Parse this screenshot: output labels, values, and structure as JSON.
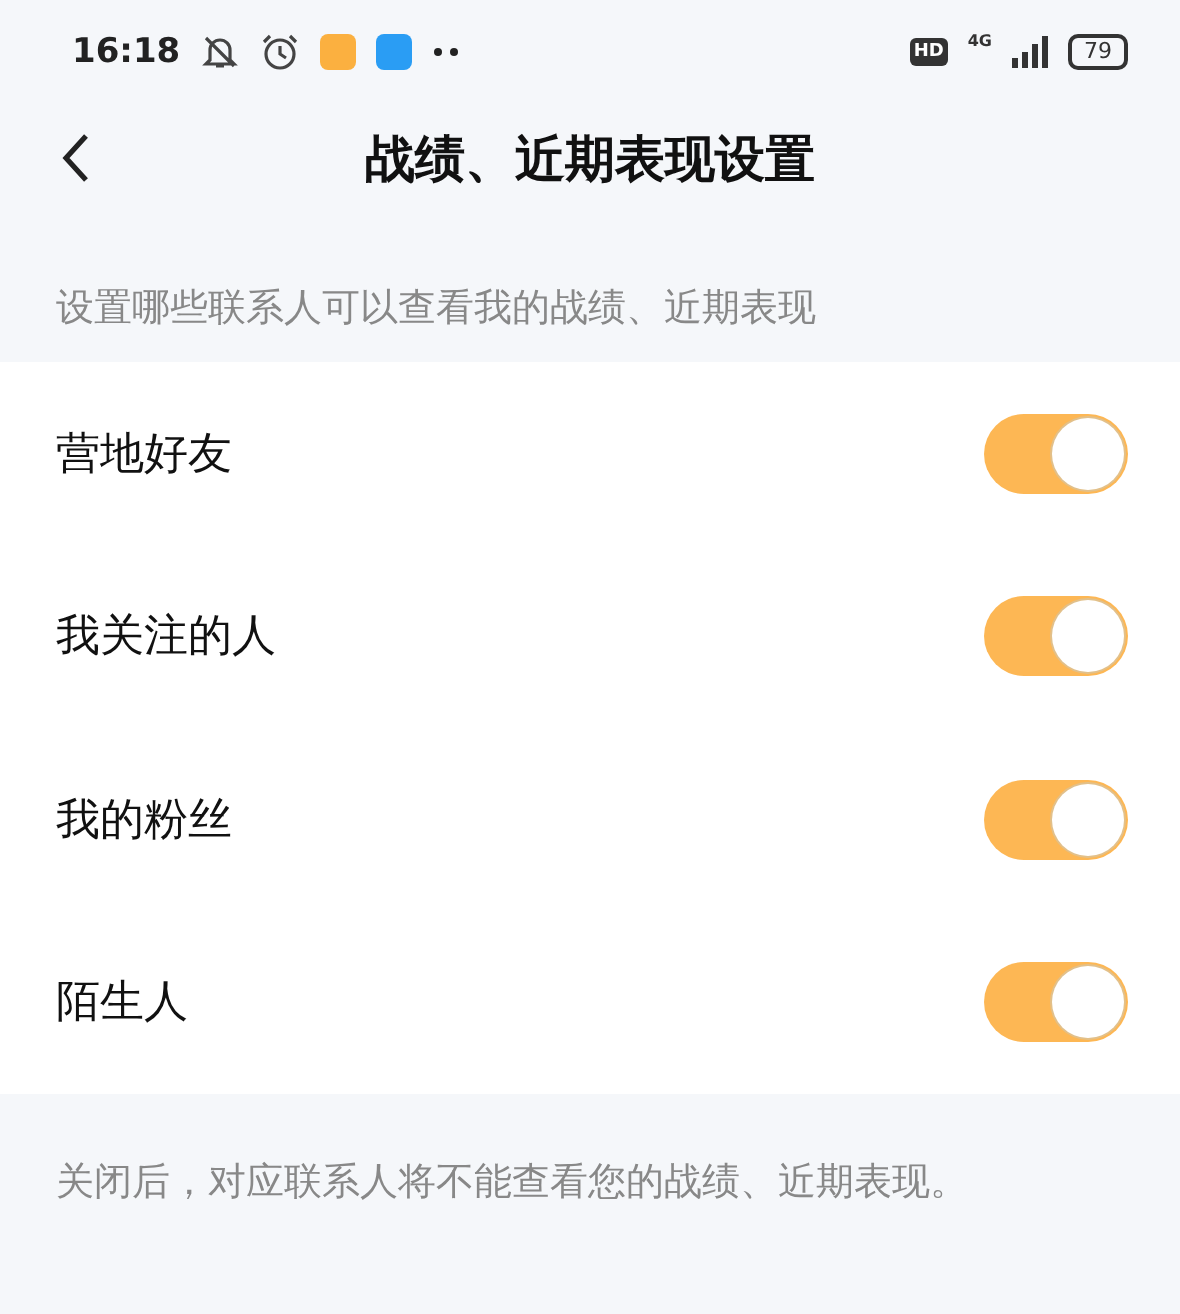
{
  "status_bar": {
    "time": "16:18",
    "hd": "HD",
    "network": "4G",
    "battery": "79"
  },
  "header": {
    "title": "战绩、近期表现设置"
  },
  "description": "设置哪些联系人可以查看我的战绩、近期表现",
  "items": [
    {
      "label": "营地好友",
      "on": true
    },
    {
      "label": "我关注的人",
      "on": true
    },
    {
      "label": "我的粉丝",
      "on": true
    },
    {
      "label": "陌生人",
      "on": true
    }
  ],
  "footer": "关闭后，对应联系人将不能查看您的战绩、近期表现。"
}
